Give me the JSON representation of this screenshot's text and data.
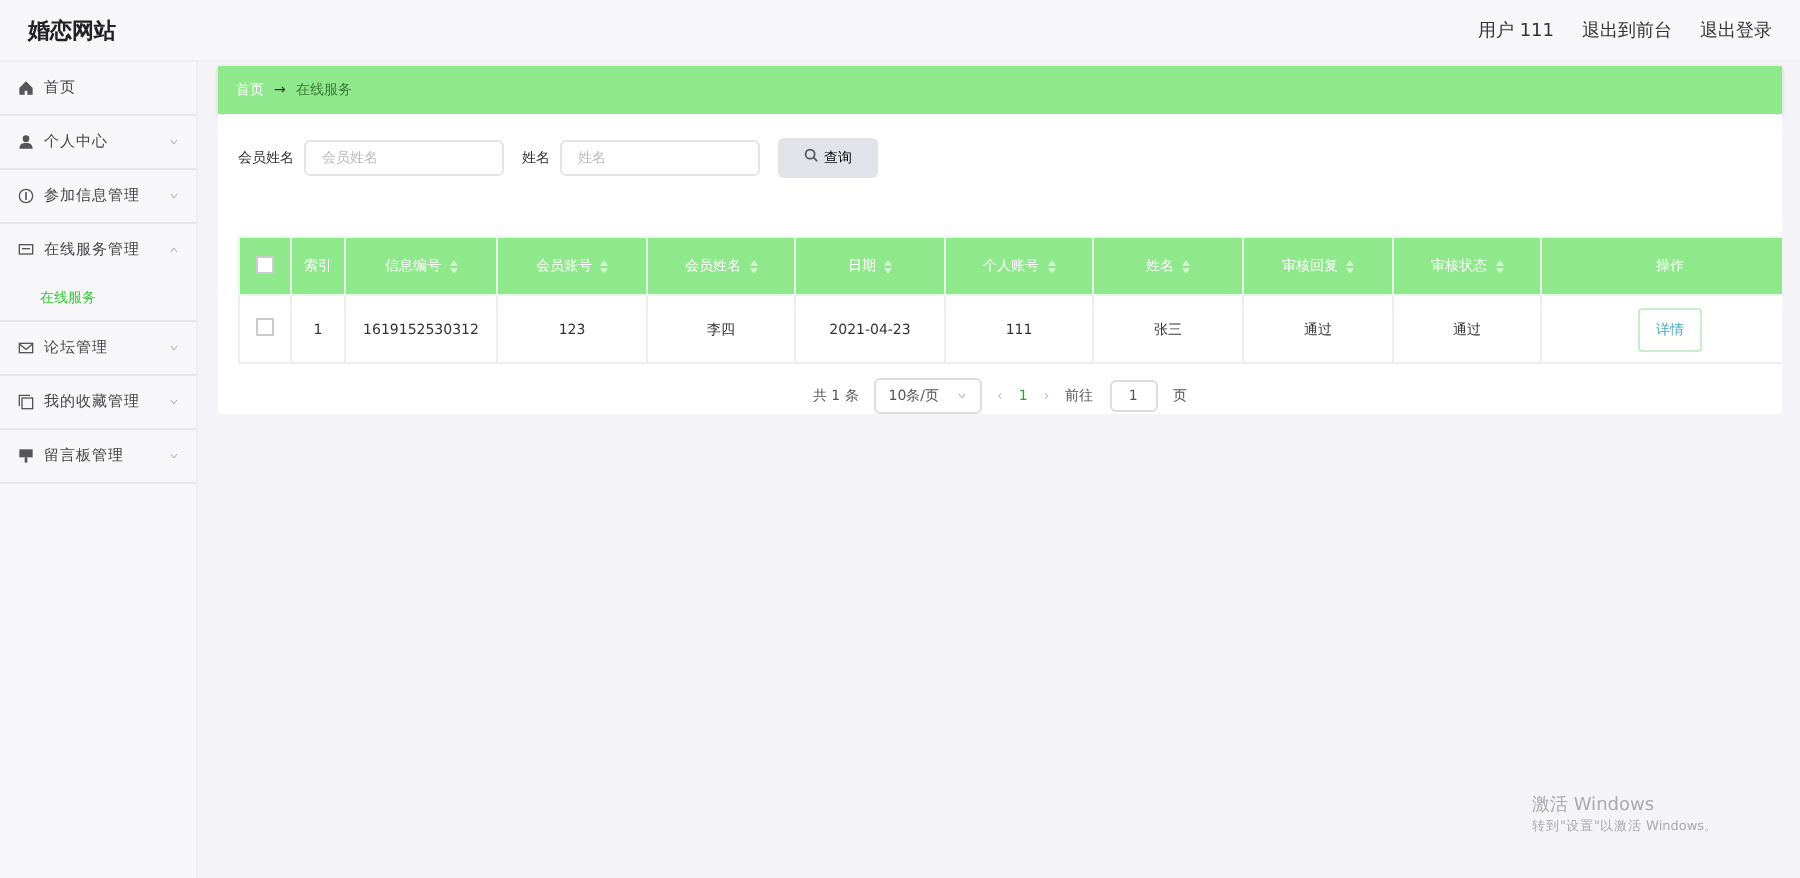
{
  "header": {
    "title": "婚恋网站",
    "user": "用户 111",
    "links": [
      "退出到前台",
      "退出登录"
    ]
  },
  "sidebar": {
    "items": [
      {
        "label": "首页"
      },
      {
        "label": "个人中心",
        "expanded": false
      },
      {
        "label": "参加信息管理",
        "expanded": false
      },
      {
        "label": "在线服务管理",
        "expanded": true,
        "children": [
          {
            "label": "在线服务",
            "selected": true
          }
        ]
      },
      {
        "label": "论坛管理",
        "expanded": false
      },
      {
        "label": "我的收藏管理",
        "expanded": false
      },
      {
        "label": "留言板管理",
        "expanded": false
      }
    ]
  },
  "breadcrumb": {
    "home": "首页",
    "separator": "→",
    "current": "在线服务"
  },
  "search": {
    "fields": [
      {
        "label": "会员姓名",
        "placeholder": "会员姓名"
      },
      {
        "label": "姓名",
        "placeholder": "姓名"
      }
    ],
    "button": "查询"
  },
  "table": {
    "all_checked": false,
    "columns": [
      {
        "label": "索引",
        "sortable": false
      },
      {
        "label": "信息编号",
        "sortable": true
      },
      {
        "label": "会员账号",
        "sortable": true
      },
      {
        "label": "会员姓名",
        "sortable": true
      },
      {
        "label": "日期",
        "sortable": true
      },
      {
        "label": "个人账号",
        "sortable": true
      },
      {
        "label": "姓名",
        "sortable": true
      },
      {
        "label": "审核回复",
        "sortable": true
      },
      {
        "label": "审核状态",
        "sortable": true
      },
      {
        "label": "操作",
        "sortable": false
      }
    ],
    "rows": [
      {
        "checked": false,
        "cells": [
          "1",
          "1619152530312",
          "123",
          "李四",
          "2021-04-23",
          "111",
          "张三",
          "通过",
          "通过"
        ],
        "action": "详情"
      }
    ]
  },
  "pagination": {
    "total": "共 1 条",
    "page_size": "10条/页",
    "pages": [
      {
        "label": "1",
        "selected": true
      }
    ],
    "prev": "‹",
    "next": "›",
    "goto_label": "前往",
    "goto_value": "1",
    "goto_unit": "页"
  },
  "activation": {
    "title": "激活 Windows",
    "text": "转到\"设置\"以激活 Windows。"
  }
}
